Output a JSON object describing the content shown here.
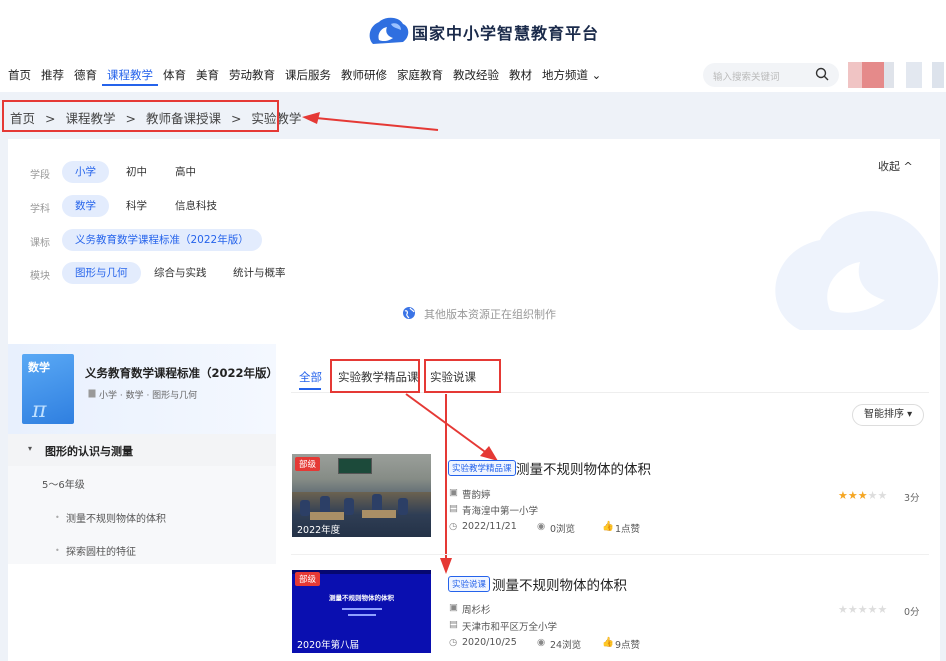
{
  "site": {
    "brand": "国家中小学智慧教育平台"
  },
  "nav": {
    "items": [
      "首页",
      "推荐",
      "德育",
      "课程教学",
      "体育",
      "美育",
      "劳动教育",
      "课后服务",
      "教师研修",
      "家庭教育",
      "教改经验",
      "教材",
      "地方频道 ⌄"
    ],
    "active_index": 3,
    "search_placeholder": "输入搜索关键词"
  },
  "breadcrumb": [
    "首页",
    "课程教学",
    "教师备课授课",
    "实验教学"
  ],
  "breadcrumb_sep": ">",
  "filters": {
    "collapse_label": "收起 ^",
    "rows": [
      {
        "label": "学段",
        "options": [
          "小学",
          "初中",
          "高中"
        ],
        "selected": 0
      },
      {
        "label": "学科",
        "options": [
          "数学",
          "科学",
          "信息科技"
        ],
        "selected": 0
      },
      {
        "label": "课标",
        "options": [
          "义务教育数学课程标准（2022年版）"
        ],
        "selected": 0
      },
      {
        "label": "模块",
        "options": [
          "图形与几何",
          "综合与实践",
          "统计与概率"
        ],
        "selected": 0
      }
    ],
    "version_note": "其他版本资源正在组织制作"
  },
  "book": {
    "subject": "数学",
    "title": "义务教育数学课程标准（2022年版）",
    "meta": "小学 · 数学 · 图形与几何",
    "pi": "π"
  },
  "tree": {
    "section": "图形的认识与测量",
    "grade": "5～6年级",
    "leaves": [
      "测量不规则物体的体积",
      "探索圆柱的特征"
    ]
  },
  "tabs": [
    "全部",
    "实验教学精品课",
    "实验说课"
  ],
  "sort_label": "智能排序 ▾",
  "results": [
    {
      "thumb_tag": "部级",
      "thumb_year": "2022年度",
      "pill": "实验教学精品课",
      "title": "测量不规则物体的体积",
      "author": "曹韵婷",
      "school": "青海湟中第一小学",
      "date": "2022/11/21",
      "views": "0浏览",
      "likes": "1点赞",
      "rating": 3,
      "score": "3分"
    },
    {
      "thumb_tag": "部级",
      "thumb_year": "2020年第八届",
      "thumb_title": "测量不规则物体的体积",
      "pill": "实验说课",
      "title": "测量不规则物体的体积",
      "author": "周杉杉",
      "school": "天津市和平区万全小学",
      "date": "2020/10/25",
      "views": "24浏览",
      "likes": "9点赞",
      "rating": 0,
      "score": "0分"
    }
  ],
  "colors": {
    "accent": "#2563eb",
    "annotation": "#e53935",
    "star": "#f5a623"
  }
}
